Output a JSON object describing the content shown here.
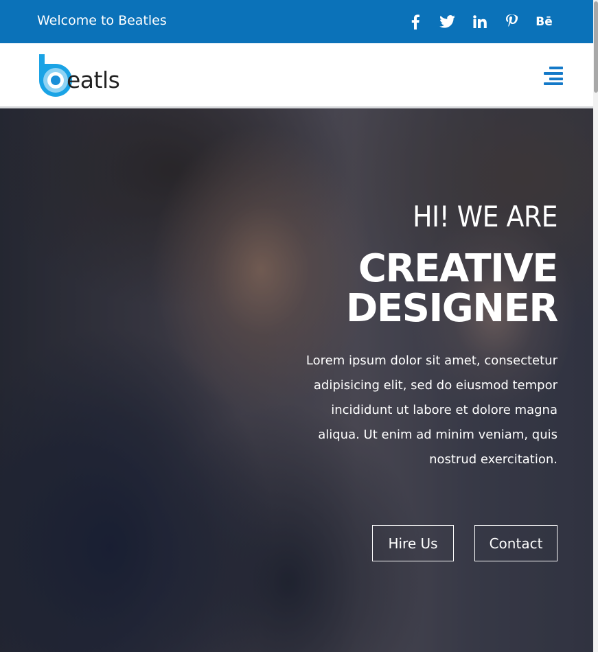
{
  "topbar": {
    "welcome": "Welcome to Beatles",
    "social": [
      {
        "name": "facebook-icon"
      },
      {
        "name": "twitter-icon"
      },
      {
        "name": "linkedin-icon"
      },
      {
        "name": "pinterest-icon"
      },
      {
        "name": "behance-icon",
        "label": "Bē"
      }
    ],
    "bg_color": "#0b72b9"
  },
  "nav": {
    "logo_text": "eatls",
    "logo_color": "#1a9fe0",
    "menu_icon": "hamburger-menu-icon",
    "menu_color": "#1479c8"
  },
  "hero": {
    "intro": "HI! WE ARE",
    "headline_line1": "CREATIVE",
    "headline_line2": "DESIGNER",
    "body": "Lorem ipsum dolor sit amet, consectetur adipisicing elit, sed do eiusmod tempor incididunt ut labore et dolore magna aliqua. Ut enim ad minim veniam, quis nostrud exercitation.",
    "buttons": {
      "hire": "Hire Us",
      "contact": "Contact"
    }
  }
}
